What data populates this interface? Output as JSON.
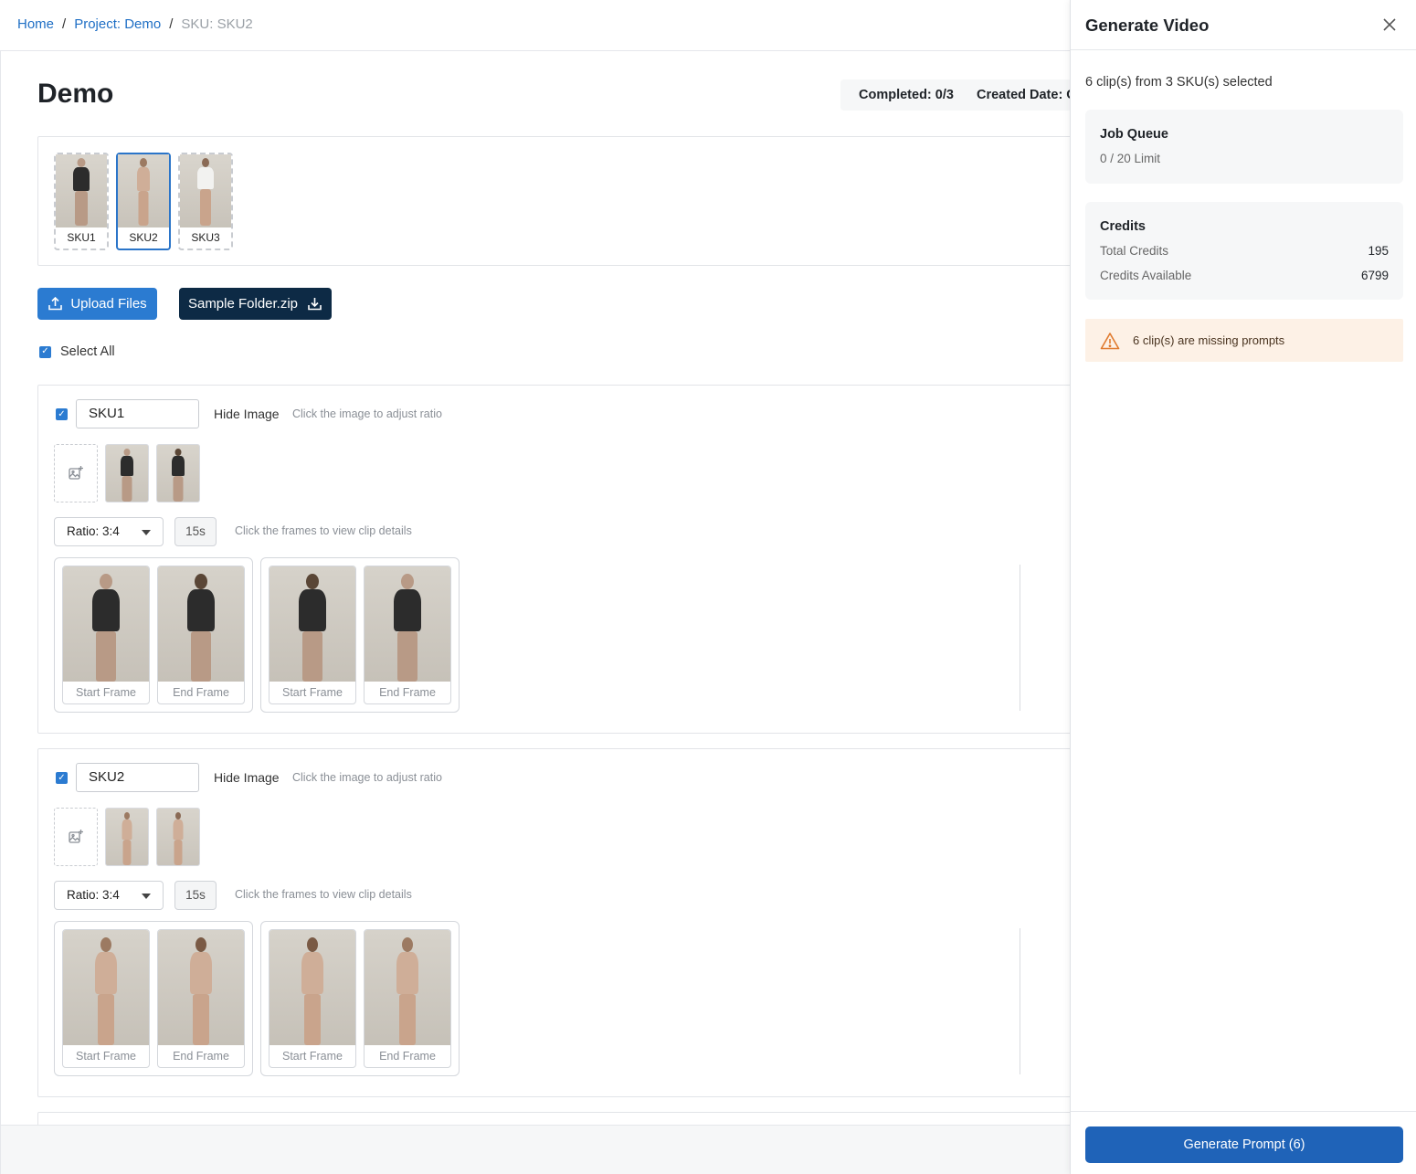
{
  "breadcrumb": {
    "home": "Home",
    "project": "Project: Demo",
    "current": "SKU: SKU2"
  },
  "project": {
    "title": "Demo",
    "completed": "Completed: 0/3",
    "created": "Created Date: C"
  },
  "sku_strip": [
    {
      "label": "SKU1",
      "selected": false,
      "outfit": "dark"
    },
    {
      "label": "SKU2",
      "selected": true,
      "outfit": "nude"
    },
    {
      "label": "SKU3",
      "selected": false,
      "outfit": "white"
    }
  ],
  "actions": {
    "upload_label": "Upload Files",
    "sample_label": "Sample Folder.zip",
    "select_all_label": "Select All"
  },
  "sku_cards": [
    {
      "name": "SKU1",
      "hide_image_label": "Hide Image",
      "ratio_hint": "Click the image to adjust ratio",
      "ratio_label": "Ratio: 3:4",
      "duration": "15s",
      "frames_hint": "Click the frames to view clip details",
      "outfit": "dark",
      "clips": [
        {
          "start": "Start Frame",
          "end": "End Frame"
        },
        {
          "start": "Start Frame",
          "end": "End Frame"
        }
      ]
    },
    {
      "name": "SKU2",
      "hide_image_label": "Hide Image",
      "ratio_hint": "Click the image to adjust ratio",
      "ratio_label": "Ratio: 3:4",
      "duration": "15s",
      "frames_hint": "Click the frames to view clip details",
      "outfit": "nude",
      "clips": [
        {
          "start": "Start Frame",
          "end": "End Frame"
        },
        {
          "start": "Start Frame",
          "end": "End Frame"
        }
      ]
    }
  ],
  "panel": {
    "title": "Generate Video",
    "selection": "6 clip(s) from 3 SKU(s) selected",
    "job_queue": {
      "heading": "Job Queue",
      "limit": "0 / 20 Limit"
    },
    "credits": {
      "heading": "Credits",
      "total_label": "Total Credits",
      "total_value": "195",
      "available_label": "Credits Available",
      "available_value": "6799"
    },
    "warning": "6 clip(s) are missing prompts",
    "generate_label": "Generate Prompt (6)"
  },
  "colors": {
    "accent": "#2b7bd1",
    "dark_button": "#0d2a45",
    "primary_action": "#1f63b8",
    "warning_bg": "#fdf1e6",
    "warning_icon": "#e07a2e"
  },
  "icons": [
    "upload-icon",
    "download-icon",
    "check-icon",
    "add-image-icon",
    "chevron-down-icon",
    "close-icon",
    "warning-icon"
  ]
}
